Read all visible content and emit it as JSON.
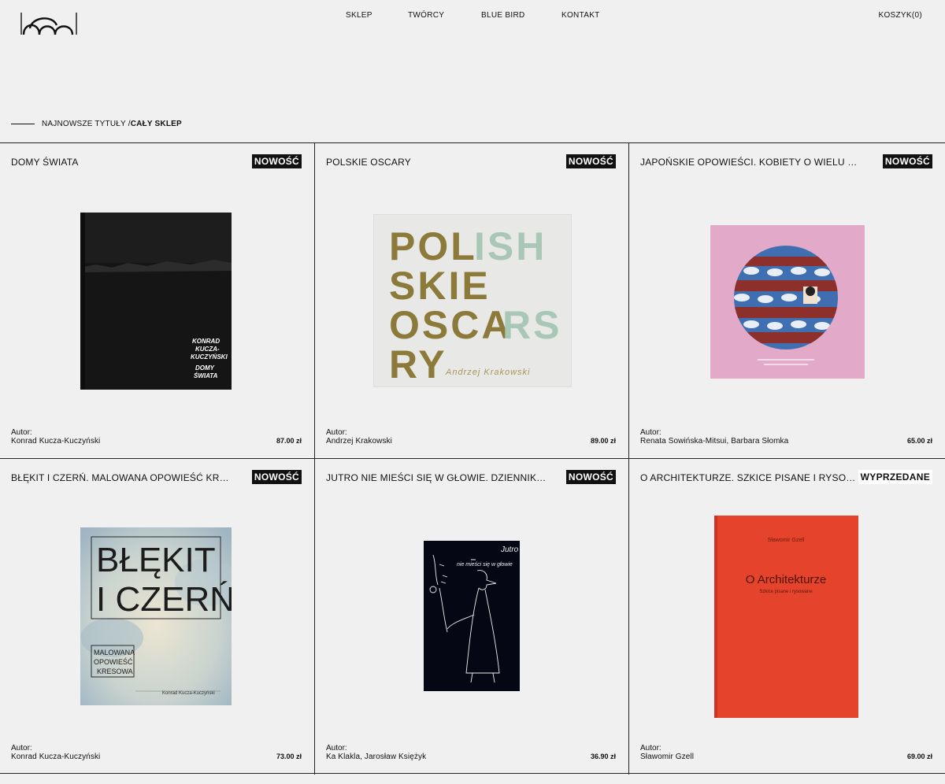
{
  "nav": {
    "items": [
      {
        "label": "SKLEP"
      },
      {
        "label": "TWÓRCY"
      },
      {
        "label": "BLUE BIRD"
      },
      {
        "label": "KONTAKT"
      }
    ],
    "cart": "KOSZYK(0)"
  },
  "breadcrumb": {
    "link": "NAJNOWSZE TYTUŁY /",
    "current": "CAŁY SKLEP"
  },
  "products": [
    {
      "title": "DOMY ŚWIATA",
      "badge": "NOWOŚĆ",
      "author_label": "Autor:",
      "author": "Konrad Kucza-Kuczyński",
      "price": "87.00 zł",
      "cover_text": [
        "KONRAD",
        "KUCZA-",
        "KUCZYŃSKI",
        "DOMY",
        "ŚWIATA"
      ]
    },
    {
      "title": "POLSKIE OSCARY",
      "badge": "NOWOŚĆ",
      "author_label": "Autor:",
      "author": "Andrzej Krakowski",
      "price": "89.00 zł",
      "cover_text": [
        "POL",
        "ISH",
        "SKIE",
        "OSCA",
        "RS",
        "RY",
        "Andrzej Krakowski"
      ]
    },
    {
      "title": "JAPOŃSKIE OPOWIEŚCI. KOBIETY O WIELU OBLICZACH",
      "badge": "NOWOŚĆ",
      "author_label": "Autor:",
      "author": "Renata Sowińska-Mitsui, Barbara Słomka",
      "price": "65.00 zł"
    },
    {
      "title": "BŁĘKIT I CZERŃ. MALOWANA OPOWIEŚĆ KRESOWA",
      "badge": "NOWOŚĆ",
      "author_label": "Autor:",
      "author": "Konrad Kucza-Kuczyński",
      "price": "73.00 zł",
      "cover_text": [
        "BŁĘKIT",
        "I CZERŃ",
        "MALOWANA",
        "OPOWIEŚĆ",
        "KRESOWA",
        "Konrad Kucza-Kuczyński"
      ]
    },
    {
      "title": "JUTRO NIE MIEŚCI SIĘ W GŁOWIE. DZIENNIKI Z PANDEMII",
      "badge": "NOWOŚĆ",
      "author_label": "Autor:",
      "author": "Ka Klakla, Jarosław Księżyk",
      "price": "36.90 zł",
      "cover_text": [
        "Jutro",
        "nie mieści się w głowie"
      ]
    },
    {
      "title": "O ARCHITEKTURZE. SZKICE PISANE I RYSOWANE",
      "badge": "WYPRZEDANE",
      "author_label": "Autor:",
      "author": "Sławomir Gzell",
      "price": "69.00 zł",
      "cover_text": [
        "Sławomir Gzell",
        "O Architekturze",
        "Szkice pisane i rysowane"
      ]
    }
  ],
  "colors": {
    "background": "#f0f0f0",
    "text": "#111111",
    "badge_new_bg": "#111111",
    "badge_sold_bg": "#ffffff",
    "accent_green": "#a9c7b6",
    "accent_gold": "#8c7a3a",
    "cover_red": "#e5432b",
    "cover_pink": "#e2a9c9"
  }
}
